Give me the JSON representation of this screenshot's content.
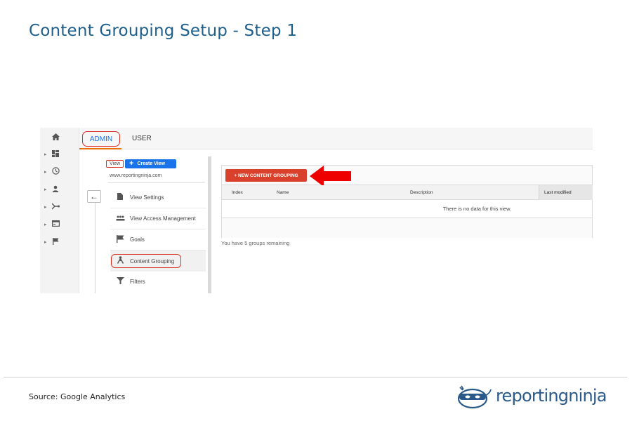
{
  "slide": {
    "title": "Content Grouping Setup - Step 1",
    "source": "Source: Google Analytics",
    "logo_text": "reportingninja"
  },
  "colors": {
    "title": "#1e5f8c",
    "highlight_outline": "#d93025",
    "primary_button": "#1a73e8",
    "new_grouping_button": "#d9412d",
    "arrow": "#ee0000"
  },
  "nav": {
    "items": [
      {
        "icon": "home-icon"
      },
      {
        "icon": "dashboard-icon"
      },
      {
        "icon": "clock-icon"
      },
      {
        "icon": "person-icon"
      },
      {
        "icon": "acquisition-icon"
      },
      {
        "icon": "behavior-icon"
      },
      {
        "icon": "flag-icon"
      }
    ]
  },
  "tabs": {
    "admin": "ADMIN",
    "user": "USER"
  },
  "view_column": {
    "view_label": "View",
    "create_view": "Create View",
    "url": "www.reportingninja.com",
    "items": [
      {
        "label": "View Settings",
        "icon": "document-icon"
      },
      {
        "label": "View Access Management",
        "icon": "people-icon"
      },
      {
        "label": "Goals",
        "icon": "flag-icon"
      },
      {
        "label": "Content Grouping",
        "icon": "content-grouping-icon"
      },
      {
        "label": "Filters",
        "icon": "filter-icon"
      }
    ]
  },
  "content_grouping": {
    "new_button": "+ NEW CONTENT GROUPING",
    "columns": [
      "Index",
      "Name",
      "Description",
      "Last modified"
    ],
    "empty_message": "There is no data for this view.",
    "remaining": "You have 5 groups remaining"
  }
}
